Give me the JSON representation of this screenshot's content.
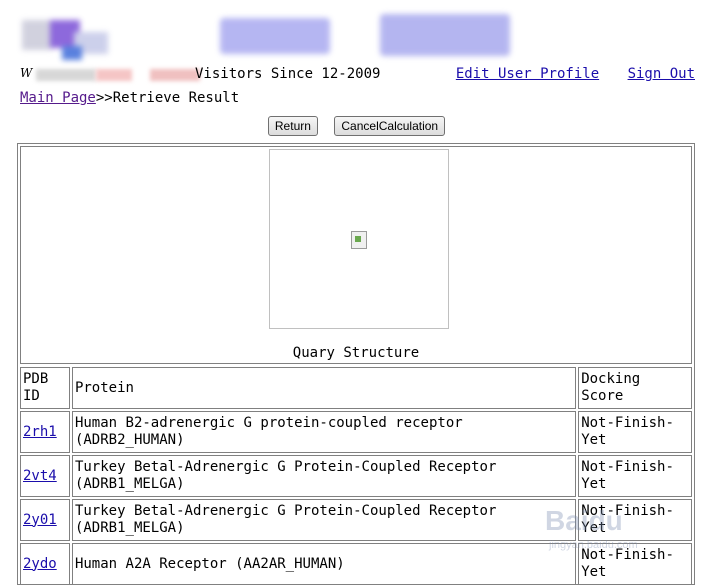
{
  "header": {
    "visitor_text": "Visitors Since 12-2009",
    "edit_profile": "Edit User Profile",
    "sign_out": "Sign Out"
  },
  "breadcrumb": {
    "main_page": "Main Page",
    "current": ">>Retrieve Result"
  },
  "buttons": {
    "return": "Return",
    "cancel": "CancelCalculation"
  },
  "structure": {
    "label": "Quary Structure"
  },
  "table": {
    "headers": {
      "pdb_id": "PDB ID",
      "protein": "Protein",
      "docking": "Docking Score"
    },
    "rows": [
      {
        "pdb_id": "2rh1",
        "protein": "Human B2-adrenergic G protein-coupled receptor (ADRB2_HUMAN)",
        "score": "Not-Finish-Yet"
      },
      {
        "pdb_id": "2vt4",
        "protein": "Turkey Betal-Adrenergic G Protein-Coupled Receptor (ADRB1_MELGA)",
        "score": "Not-Finish-Yet"
      },
      {
        "pdb_id": "2y01",
        "protein": "Turkey Betal-Adrenergic G Protein-Coupled Receptor (ADRB1_MELGA)",
        "score": "Not-Finish-Yet"
      },
      {
        "pdb_id": "2ydo",
        "protein": "Human A2A Receptor (AA2AR_HUMAN)",
        "score": "Not-Finish-Yet"
      }
    ]
  },
  "watermark": {
    "text": "Baidu",
    "sub": "jingyan.baidu.com"
  }
}
